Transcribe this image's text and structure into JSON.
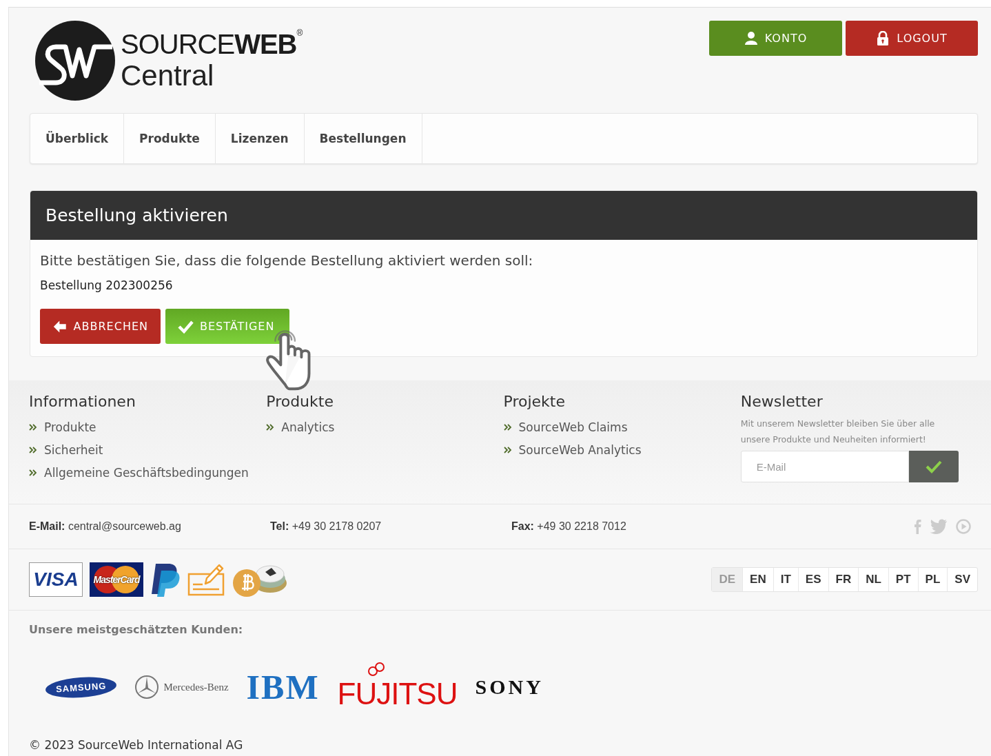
{
  "header": {
    "logo": {
      "word_light": "SOURCE",
      "word_bold": "WEB",
      "registered": "®",
      "subtitle": "Central"
    },
    "buttons": [
      {
        "label": "KONTO",
        "kind": "account"
      },
      {
        "label": "LOGOUT",
        "kind": "logout"
      }
    ]
  },
  "nav": {
    "tabs": [
      {
        "label": "Überblick"
      },
      {
        "label": "Produkte"
      },
      {
        "label": "Lizenzen"
      },
      {
        "label": "Bestellungen"
      }
    ]
  },
  "panel": {
    "title": "Bestellung aktivieren",
    "message": "Bitte bestätigen Sie, dass die folgende Bestellung aktiviert werden soll:",
    "order": "Bestellung 202300256",
    "buttons": [
      {
        "label": "ABBRECHEN",
        "kind": "cancel"
      },
      {
        "label": "BESTÄTIGEN",
        "kind": "confirm"
      }
    ]
  },
  "footer": {
    "columns": [
      {
        "heading": "Informationen",
        "links": [
          "Produkte",
          "Sicherheit",
          "Allgemeine Geschäftsbedingungen"
        ]
      },
      {
        "heading": "Produkte",
        "links": [
          "Analytics"
        ]
      },
      {
        "heading": "Projekte",
        "links": [
          "SourceWeb Claims",
          "SourceWeb Analytics"
        ]
      }
    ],
    "newsletter": {
      "heading": "Newsletter",
      "text": "Mit unserem Newsletter bleiben Sie über alle unsere Produkte und Neuheiten informiert!",
      "placeholder": "E-Mail"
    }
  },
  "contact": [
    {
      "label": "E-Mail:",
      "value": "central@sourceweb.ag"
    },
    {
      "label": "Tel:",
      "value": "+49 30 2178 0207"
    },
    {
      "label": "Fax:",
      "value": "+49 30 2218 7012"
    }
  ],
  "social": [
    {
      "kind": "facebook"
    },
    {
      "kind": "twitter"
    },
    {
      "kind": "youtube"
    }
  ],
  "payment_logos": [
    {
      "kind": "visa",
      "text": "VISA"
    },
    {
      "kind": "mastercard",
      "text": "MasterCard"
    },
    {
      "kind": "paypal"
    },
    {
      "kind": "check"
    },
    {
      "kind": "crypto"
    }
  ],
  "languages": [
    {
      "code": "DE",
      "selected": true
    },
    {
      "code": "EN",
      "selected": false
    },
    {
      "code": "IT",
      "selected": false
    },
    {
      "code": "ES",
      "selected": false
    },
    {
      "code": "FR",
      "selected": false
    },
    {
      "code": "NL",
      "selected": false
    },
    {
      "code": "PT",
      "selected": false
    },
    {
      "code": "PL",
      "selected": false
    },
    {
      "code": "SV",
      "selected": false
    }
  ],
  "customers": {
    "title": "Unsere meistgeschätzten Kunden:",
    "logos": [
      {
        "kind": "samsung",
        "text": "SAMSUNG"
      },
      {
        "kind": "mercedes",
        "text": "Mercedes-Benz"
      },
      {
        "kind": "ibm",
        "text": "IBM"
      },
      {
        "kind": "fujitsu",
        "text": "FUJITSU"
      },
      {
        "kind": "sony",
        "text": "SONY"
      }
    ]
  },
  "copyright": "© 2023 SourceWeb International AG"
}
